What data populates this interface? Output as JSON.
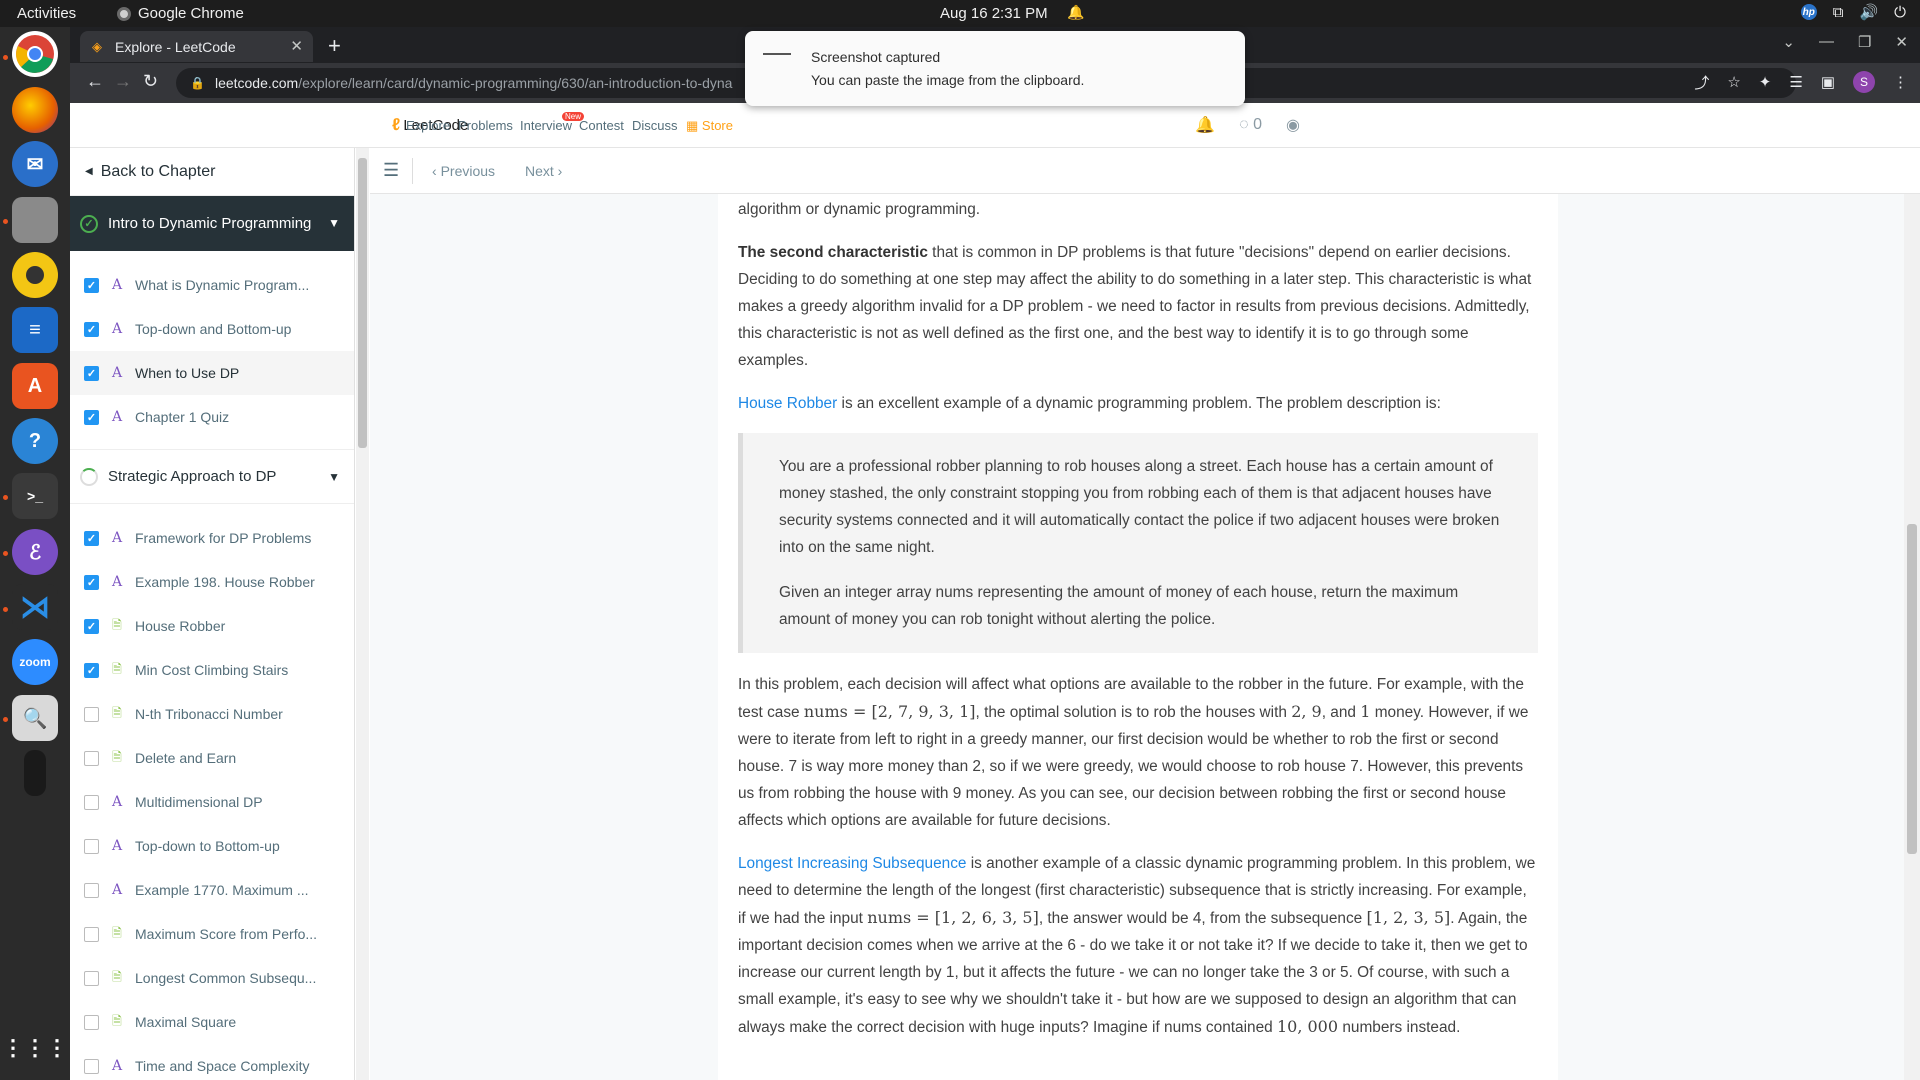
{
  "system": {
    "activities": "Activities",
    "app_name": "Google Chrome",
    "clock": "Aug 16  2:31 PM"
  },
  "browser": {
    "tab_title": "Explore - LeetCode",
    "url_host": "leetcode.com",
    "url_path": "/explore/learn/card/dynamic-programming/630/an-introduction-to-dyna"
  },
  "notification": {
    "title": "Screenshot captured",
    "body": "You can paste the image from the clipboard."
  },
  "lc_header": {
    "logo": "LeetCode",
    "nav": [
      "Explore",
      "Problems",
      "Interview",
      "Contest",
      "Discuss",
      "Store"
    ],
    "new_badge": "New",
    "coins": "0"
  },
  "sidebar": {
    "back": "Back to Chapter",
    "chapters": [
      {
        "title": "Intro to Dynamic Programming",
        "lessons": [
          {
            "label": "What is Dynamic Program...",
            "type": "article",
            "done": true
          },
          {
            "label": "Top-down and Bottom-up",
            "type": "article",
            "done": true
          },
          {
            "label": "When to Use DP",
            "type": "article",
            "done": true,
            "current": true
          },
          {
            "label": "Chapter 1 Quiz",
            "type": "article",
            "done": true
          }
        ]
      },
      {
        "title": "Strategic Approach to DP",
        "lessons": [
          {
            "label": "Framework for DP Problems",
            "type": "article",
            "done": true
          },
          {
            "label": "Example 198. House Robber",
            "type": "article",
            "done": true
          },
          {
            "label": "House Robber",
            "type": "problem",
            "done": true
          },
          {
            "label": "Min Cost Climbing Stairs",
            "type": "problem",
            "done": true
          },
          {
            "label": "N-th Tribonacci Number",
            "type": "problem",
            "done": false
          },
          {
            "label": "Delete and Earn",
            "type": "problem",
            "done": false
          },
          {
            "label": "Multidimensional DP",
            "type": "article",
            "done": false
          },
          {
            "label": "Top-down to Bottom-up",
            "type": "article",
            "done": false
          },
          {
            "label": "Example 1770. Maximum ...",
            "type": "article",
            "done": false
          },
          {
            "label": "Maximum Score from Perfo...",
            "type": "problem",
            "done": false
          },
          {
            "label": "Longest Common Subsequ...",
            "type": "problem",
            "done": false
          },
          {
            "label": "Maximal Square",
            "type": "problem",
            "done": false
          },
          {
            "label": "Time and Space Complexity",
            "type": "article",
            "done": false
          }
        ]
      }
    ]
  },
  "content_bar": {
    "previous": "Previous",
    "next": "Next"
  },
  "article": {
    "p0": "algorithm or dynamic programming.",
    "p1_bold": "The second characteristic",
    "p1_rest": " that is common in DP problems is that future \"decisions\" depend on earlier decisions. Deciding to do something at one step may affect the ability to do something in a later step. This characteristic is what makes a greedy algorithm invalid for a DP problem - we need to factor in results from previous decisions. Admittedly, this characteristic is not as well defined as the first one, and the best way to identify it is to go through some examples.",
    "p2_link": "House Robber",
    "p2_rest": " is an excellent example of a dynamic programming problem. The problem description is:",
    "quote1": "You are a professional robber planning to rob houses along a street. Each house has a certain amount of money stashed, the only constraint stopping you from robbing each of them is that adjacent houses have security systems connected and it will automatically contact the police if two adjacent houses were broken into on the same night.",
    "quote2": "Given an integer array nums representing the amount of money of each house, return the maximum amount of money you can rob tonight without alerting the police.",
    "p3_a": "In this problem, each decision will affect what options are available to the robber in the future. For example, with the test case ",
    "p3_math1": "nums = [2, 7, 9, 3, 1]",
    "p3_b": ", the optimal solution is to rob the houses with ",
    "p3_math2": "2, 9",
    "p3_c": ", and ",
    "p3_math3": "1",
    "p3_d": " money. However, if we were to iterate from left to right in a greedy manner, our first decision would be whether to rob the first or second house. 7 is way more money than 2, so if we were greedy, we would choose to rob house 7. However, this prevents us from robbing the house with 9 money. As you can see, our decision between robbing the first or second house affects which options are available for future decisions.",
    "p4_link": "Longest Increasing Subsequence",
    "p4_a": " is another example of a classic dynamic programming problem. In this problem, we need to determine the length of the longest (first characteristic) subsequence that is strictly increasing. For example, if we had the input ",
    "p4_math1": "nums = [1, 2, 6, 3, 5]",
    "p4_b": ", the answer would be 4, from the subsequence ",
    "p4_math2": "[1, 2, 3, 5]",
    "p4_c": ". Again, the important decision comes when we arrive at the 6 - do we take it or not take it? If we decide to take it, then we get to increase our current length by 1, but it affects the future - we can no longer take the 3 or 5. Of course, with such a small example, it's easy to see why we shouldn't take it - but how are we supposed to design an algorithm that can always make the correct decision with huge inputs? Imagine if nums contained ",
    "p4_math3": "10, 000",
    "p4_d": " numbers instead."
  },
  "colors": {
    "accent": "#ffa116",
    "link": "#1e88e5",
    "checkbox": "#2196f3",
    "active_chapter_bg": "#263238"
  }
}
